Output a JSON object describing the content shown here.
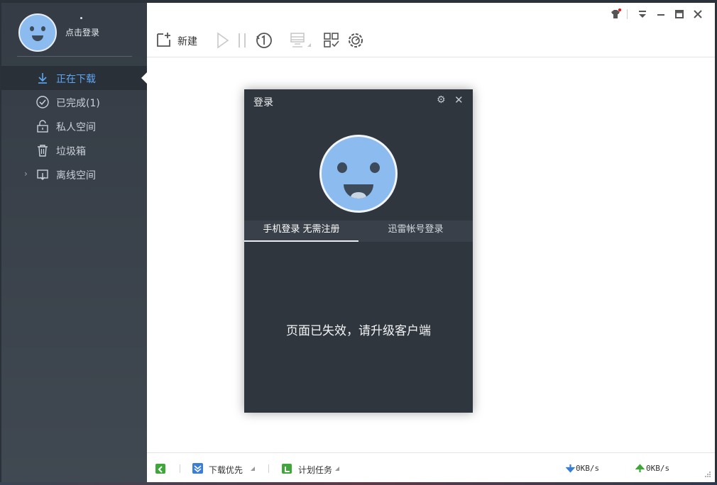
{
  "user": {
    "login_label": "点击登录"
  },
  "sidebar": {
    "items": [
      {
        "label": "正在下载",
        "icon": "download-icon"
      },
      {
        "label": "已完成(1)",
        "icon": "check-circle-icon"
      },
      {
        "label": "私人空间",
        "icon": "lock-icon"
      },
      {
        "label": "垃圾箱",
        "icon": "trash-icon"
      },
      {
        "label": "离线空间",
        "icon": "cloud-icon"
      }
    ]
  },
  "toolbar": {
    "new_label": "新建"
  },
  "dialog": {
    "title": "登录",
    "tabs": [
      {
        "label": "手机登录  无需注册"
      },
      {
        "label": "迅雷帐号登录"
      }
    ],
    "message": "页面已失效，请升级客户端"
  },
  "statusbar": {
    "priority_label": "下载优先",
    "schedule_label": "计划任务",
    "download_speed": "0KB/s",
    "upload_speed": "0KB/s"
  },
  "colors": {
    "accent": "#5da8f5",
    "sidebar_bg": "#3a414a",
    "dialog_bg": "#2f363e",
    "avatar": "#8cbcef",
    "green": "#3fa63a"
  }
}
